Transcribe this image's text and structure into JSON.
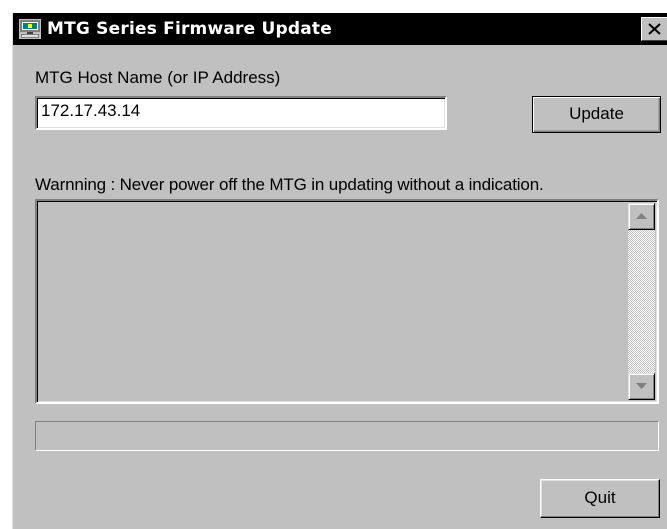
{
  "window": {
    "title": "MTG Series Firmware Update",
    "icon": "firmware-update-icon",
    "close_glyph": "close-icon"
  },
  "form": {
    "host_label": "MTG Host Name (or IP Address)",
    "host_value": "172.17.43.14",
    "update_label": "Update",
    "warning": "Warnning : Never power off the MTG in updating without a indication."
  },
  "log": {
    "text": ""
  },
  "progress": {
    "value": 0
  },
  "footer": {
    "quit_label": "Quit"
  }
}
